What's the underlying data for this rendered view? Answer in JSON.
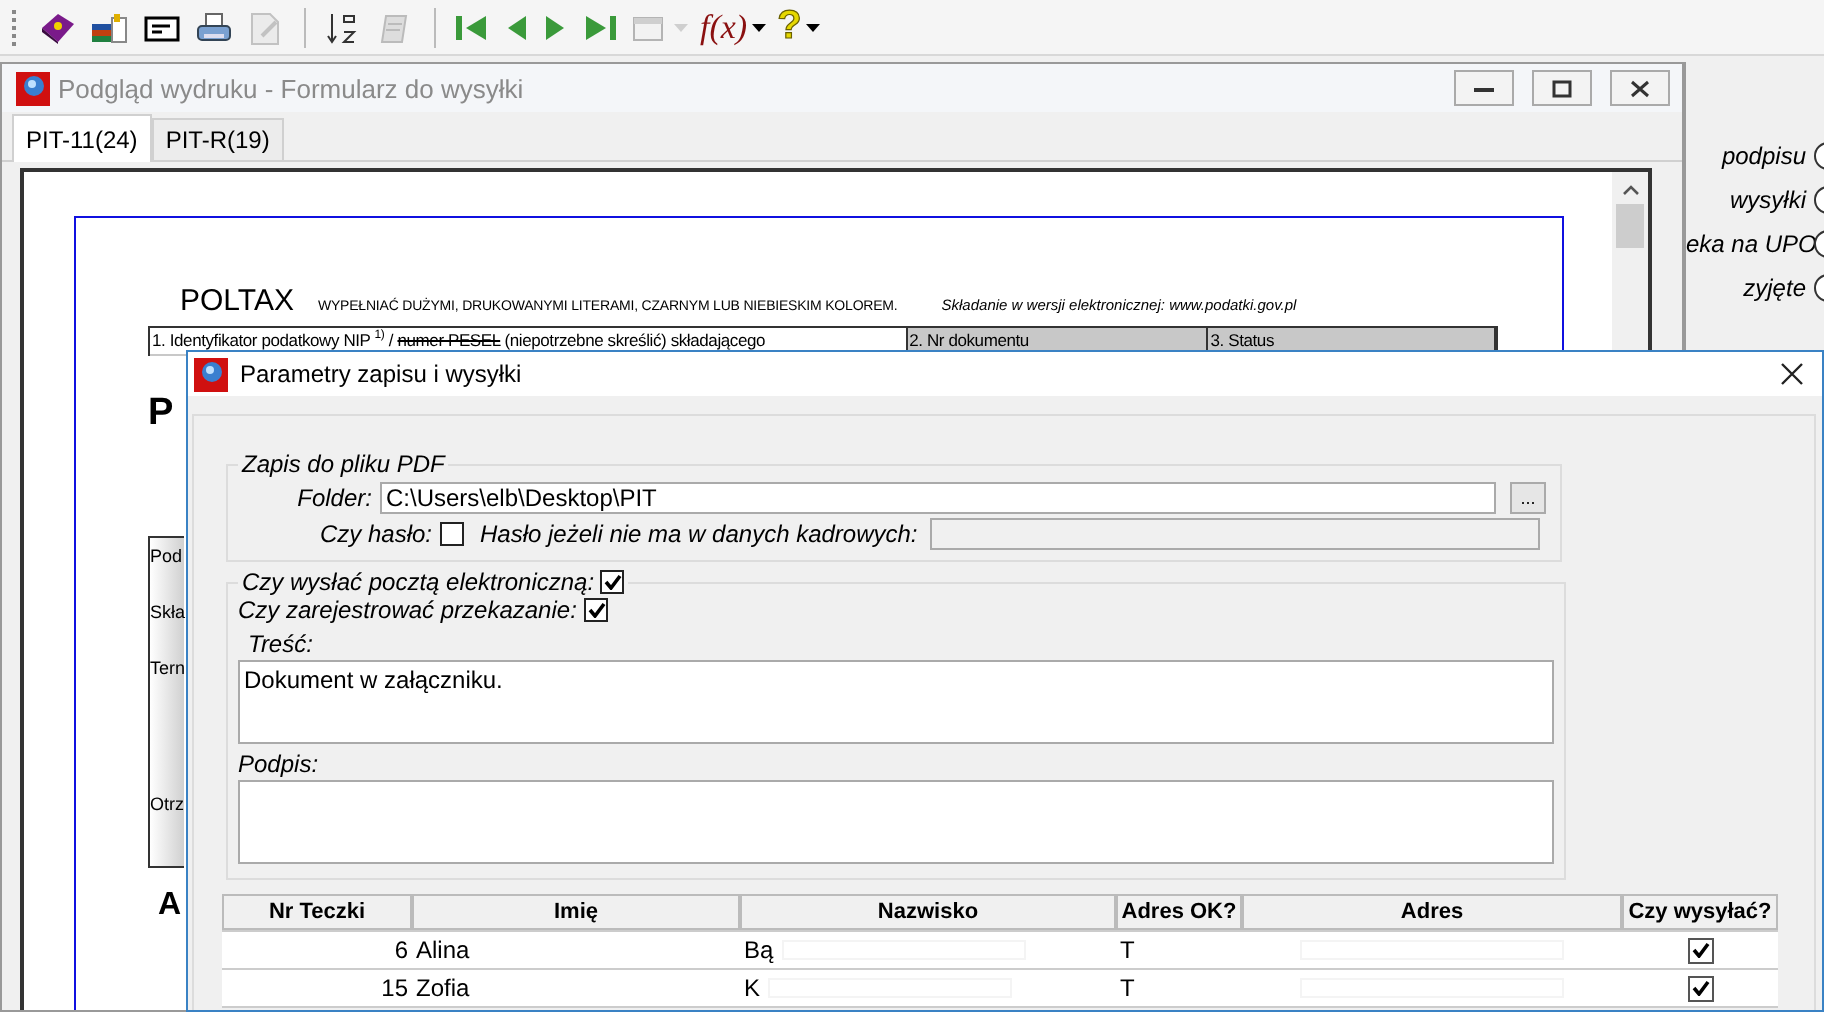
{
  "toolbar": [
    {
      "kind": "book",
      "disabled": false
    },
    {
      "kind": "books",
      "disabled": false
    },
    {
      "kind": "card",
      "disabled": false
    },
    {
      "kind": "printer",
      "disabled": false
    },
    {
      "kind": "document",
      "disabled": true
    },
    {
      "kind": "sort",
      "disabled": false
    },
    {
      "kind": "stack",
      "disabled": true
    },
    {
      "kind": "first",
      "disabled": false
    },
    {
      "kind": "prev",
      "disabled": false
    },
    {
      "kind": "next",
      "disabled": false
    },
    {
      "kind": "last",
      "disabled": false
    },
    {
      "kind": "window",
      "disabled": true,
      "dropdown": true
    },
    {
      "kind": "function",
      "label": "f(x)",
      "disabled": false,
      "dropdown": true
    },
    {
      "kind": "help",
      "label": "?",
      "disabled": false,
      "dropdown": true
    }
  ],
  "preview": {
    "title": "Podgląd wydruku - Formularz do wysyłki",
    "tabs": [
      {
        "label": "PIT-11(24)",
        "selected": true
      },
      {
        "label": "PIT-R(19)",
        "selected": false
      }
    ],
    "document": {
      "brand": "POLTAX",
      "instruction": "WYPEŁNIAĆ DUŻYMI, DRUKOWANYMI LITERAMI, CZARNYM LUB NIEBIESKIM KOLOREM.",
      "online_note": "Składanie w wersji elektronicznej: www.podatki.gov.pl",
      "fields": [
        {
          "label": "1. Identyfikator podatkowy NIP $^{1)}$ / ",
          "struck": "numer PESEL",
          "after": " (niepotrzebne skreślić) składającego"
        },
        {
          "label": "2. Nr dokumentu"
        },
        {
          "label": "3. Status"
        }
      ],
      "title_fragment": "P",
      "side_labels": [
        "Pod",
        "Skła",
        "Tern",
        "Otrz"
      ],
      "section_fragment": "A"
    }
  },
  "right_panel": {
    "options": [
      {
        "label": "podpisu",
        "selected": false
      },
      {
        "label": "wysyłki",
        "selected": false
      },
      {
        "label": "eka na UPO",
        "selected": false
      },
      {
        "label": "zyjęte",
        "selected": false
      }
    ]
  },
  "dialog": {
    "title": "Parametry zapisu i wysyłki",
    "pdf_group": {
      "legend": "Zapis do pliku PDF",
      "folder_label": "Folder:",
      "folder_value": "C:\\Users\\elb\\Desktop\\PIT",
      "browse_label": "...",
      "password_label": "Czy hasło:",
      "password_checked": false,
      "fallback_label": "Hasło jeżeli nie ma w danych kadrowych:",
      "fallback_disabled": true
    },
    "email_group": {
      "legend": "Czy wysłać pocztą elektroniczną:",
      "send_checked": true,
      "register_label": "Czy zarejestrować przekazanie:",
      "register_checked": true,
      "body_label": "Treść:",
      "body_value": "Dokument w załączniku.",
      "signature_label": "Podpis:"
    },
    "table": {
      "columns": [
        "Nr Teczki",
        "Imię",
        "Nazwisko",
        "Adres OK?",
        "Adres",
        "Czy wysyłać?"
      ],
      "rows": [
        {
          "nr": "6",
          "first_name": "Alina",
          "last_name": "Bą",
          "address_ok": "T",
          "send": true
        },
        {
          "nr": "15",
          "first_name": "Zofia",
          "last_name": "K",
          "address_ok": "T",
          "send": true
        }
      ]
    }
  }
}
